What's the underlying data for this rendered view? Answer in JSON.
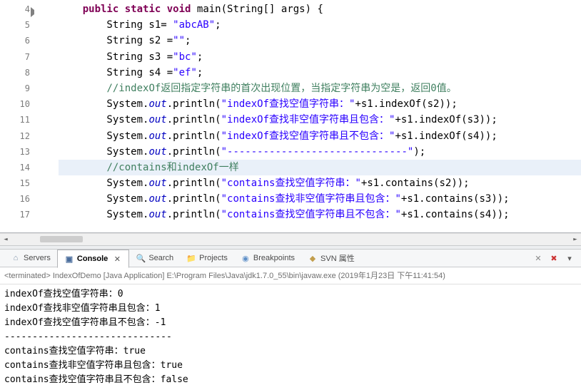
{
  "editor": {
    "lines": [
      {
        "num": "4",
        "mark": true,
        "html": [
          [
            "pln",
            "    "
          ],
          [
            "kw",
            "public"
          ],
          [
            "pln",
            " "
          ],
          [
            "kw",
            "static"
          ],
          [
            "pln",
            " "
          ],
          [
            "kw",
            "void"
          ],
          [
            "pln",
            " main(String[] args) {"
          ]
        ]
      },
      {
        "num": "5",
        "html": [
          [
            "pln",
            "        String s1= "
          ],
          [
            "str",
            "\"abcAB\""
          ],
          [
            "pln",
            ";"
          ]
        ]
      },
      {
        "num": "6",
        "html": [
          [
            "pln",
            "        String s2 ="
          ],
          [
            "str",
            "\"\""
          ],
          [
            "pln",
            ";"
          ]
        ]
      },
      {
        "num": "7",
        "html": [
          [
            "pln",
            "        String s3 ="
          ],
          [
            "str",
            "\"bc\""
          ],
          [
            "pln",
            ";"
          ]
        ]
      },
      {
        "num": "8",
        "html": [
          [
            "pln",
            "        String s4 ="
          ],
          [
            "str",
            "\"ef\""
          ],
          [
            "pln",
            ";"
          ]
        ]
      },
      {
        "num": "9",
        "html": [
          [
            "pln",
            "        "
          ],
          [
            "cmt",
            "//indexOf返回指定字符串的首次出现位置，当指定字符串为空是，返回0值。"
          ]
        ]
      },
      {
        "num": "10",
        "html": [
          [
            "pln",
            "        System."
          ],
          [
            "fld",
            "out"
          ],
          [
            "pln",
            ".println("
          ],
          [
            "str",
            "\"indexOf查找空值字符串：\""
          ],
          [
            "pln",
            "+s1.indexOf(s2));"
          ]
        ]
      },
      {
        "num": "11",
        "html": [
          [
            "pln",
            "        System."
          ],
          [
            "fld",
            "out"
          ],
          [
            "pln",
            ".println("
          ],
          [
            "str",
            "\"indexOf查找非空值字符串且包含：\""
          ],
          [
            "pln",
            "+s1.indexOf(s3));"
          ]
        ]
      },
      {
        "num": "12",
        "html": [
          [
            "pln",
            "        System."
          ],
          [
            "fld",
            "out"
          ],
          [
            "pln",
            ".println("
          ],
          [
            "str",
            "\"indexOf查找空值字符串且不包含：\""
          ],
          [
            "pln",
            "+s1.indexOf(s4));"
          ]
        ]
      },
      {
        "num": "13",
        "html": [
          [
            "pln",
            "        System."
          ],
          [
            "fld",
            "out"
          ],
          [
            "pln",
            ".println("
          ],
          [
            "str",
            "\"------------------------------\""
          ],
          [
            "pln",
            ");"
          ]
        ]
      },
      {
        "num": "14",
        "hl": true,
        "html": [
          [
            "pln",
            "        "
          ],
          [
            "cmt",
            "//contains和indexOf一样"
          ]
        ]
      },
      {
        "num": "15",
        "html": [
          [
            "pln",
            "        System."
          ],
          [
            "fld",
            "out"
          ],
          [
            "pln",
            ".println("
          ],
          [
            "str",
            "\"contains查找空值字符串：\""
          ],
          [
            "pln",
            "+s1.contains(s2));"
          ]
        ]
      },
      {
        "num": "16",
        "html": [
          [
            "pln",
            "        System."
          ],
          [
            "fld",
            "out"
          ],
          [
            "pln",
            ".println("
          ],
          [
            "str",
            "\"contains查找非空值字符串且包含：\""
          ],
          [
            "pln",
            "+s1.contains(s3));"
          ]
        ]
      },
      {
        "num": "17",
        "html": [
          [
            "pln",
            "        System."
          ],
          [
            "fld",
            "out"
          ],
          [
            "pln",
            ".println("
          ],
          [
            "str",
            "\"contains查找空值字符串且不包含：\""
          ],
          [
            "pln",
            "+s1.contains(s4));"
          ]
        ]
      }
    ]
  },
  "tabs": {
    "servers": "Servers",
    "console": "Console",
    "search": "Search",
    "projects": "Projects",
    "breakpoints": "Breakpoints",
    "svn": "SVN 属性"
  },
  "toolbar": {
    "close_icon": "✕",
    "remove_all_icon": "✖",
    "menu_icon": "▾"
  },
  "console_tab_close": "✕",
  "console_header": "<terminated> IndexOfDemo [Java Application] E:\\Program Files\\Java\\jdk1.7.0_55\\bin\\javaw.exe (2019年1月23日 下午11:41:54)",
  "console_output": [
    "indexOf查找空值字符串：0",
    "indexOf查找非空值字符串且包含：1",
    "indexOf查找空值字符串且不包含：-1",
    "------------------------------",
    "contains查找空值字符串：true",
    "contains查找非空值字符串且包含：true",
    "contains查找空值字符串且不包含：false"
  ]
}
